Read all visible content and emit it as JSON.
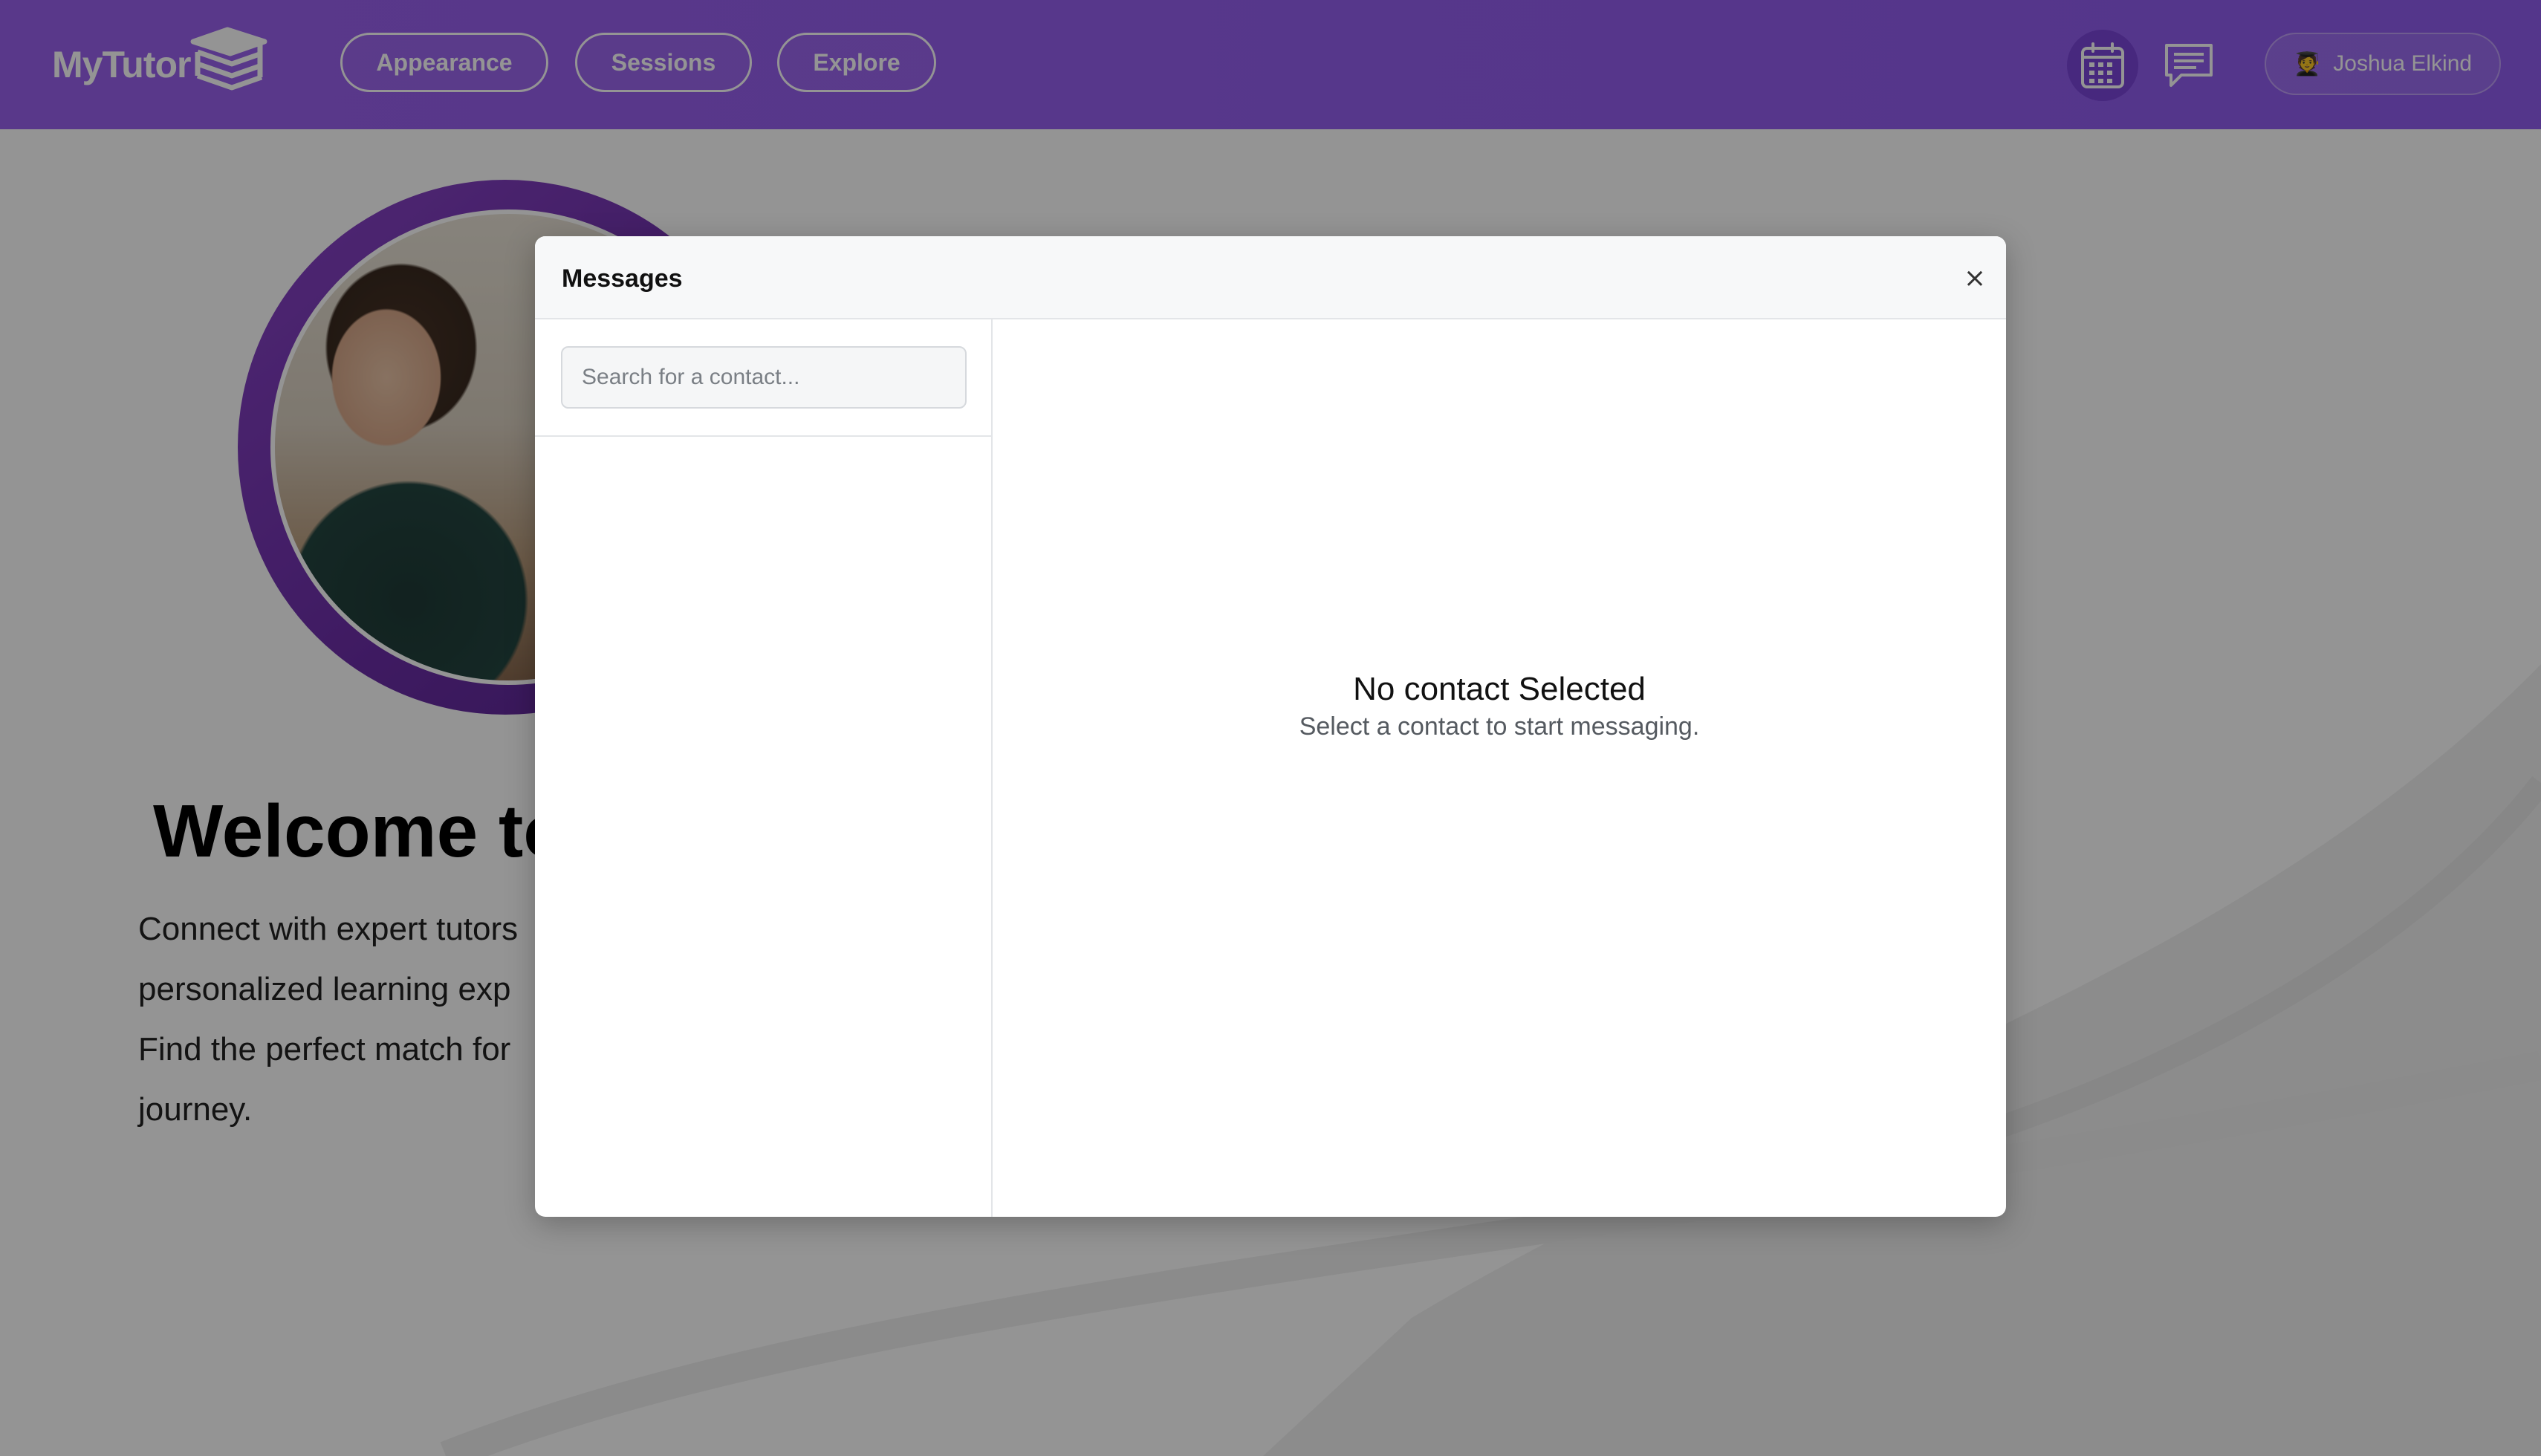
{
  "header": {
    "logo_text": "MyTutor",
    "nav": [
      {
        "label": "Appearance"
      },
      {
        "label": "Sessions"
      },
      {
        "label": "Explore"
      }
    ],
    "profile": {
      "emoji": "🧑‍🎓",
      "name": "Joshua Elkind"
    },
    "icons": [
      "calendar-icon",
      "chat-icon"
    ],
    "colors": {
      "header_start": "#9a61ee",
      "header_end": "#915df0",
      "calendar_circle": "#7a45d9"
    }
  },
  "hero": {
    "title": "Welcome to",
    "lines": [
      "Connect with expert tutors",
      "personalized learning exp",
      "Find the perfect match for",
      "journey."
    ]
  },
  "messages_modal": {
    "title": "Messages",
    "close_symbol": "×",
    "search": {
      "placeholder": "Search for a contact...",
      "value": ""
    },
    "contacts": [],
    "empty_state": {
      "title": "No contact Selected",
      "subtitle": "Select a contact to start messaging."
    }
  }
}
